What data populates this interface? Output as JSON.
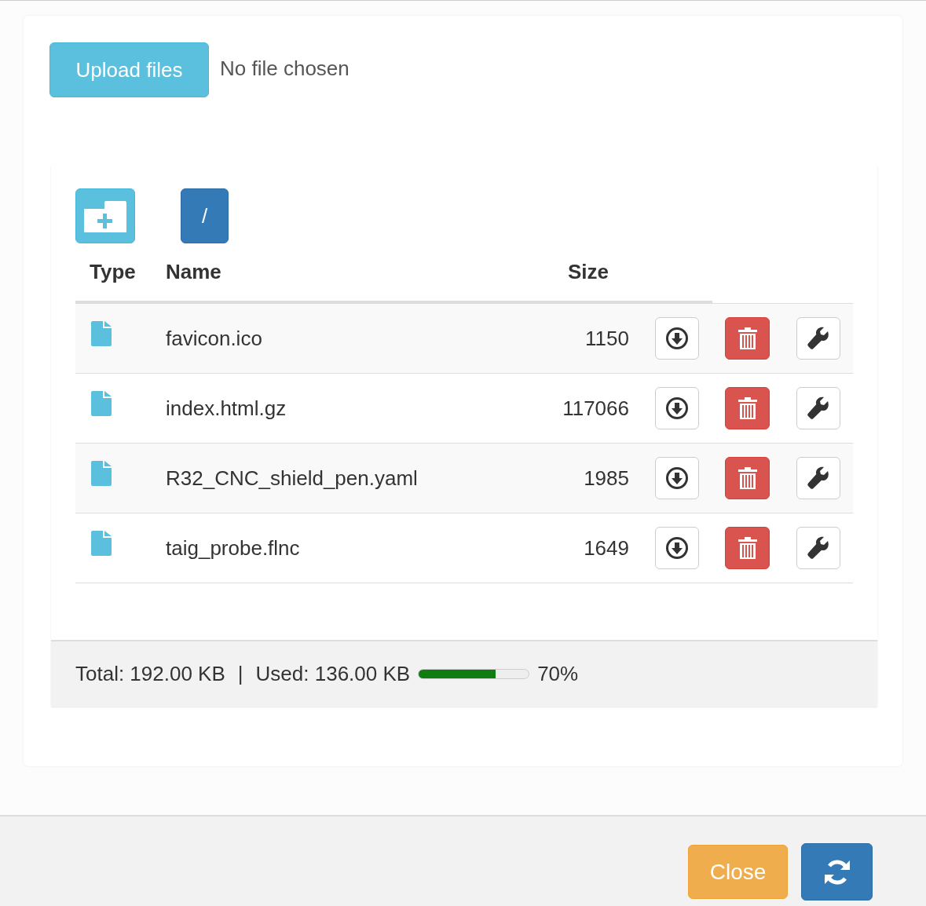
{
  "upload": {
    "button": "Upload files",
    "status": "No file chosen"
  },
  "toolbar": {
    "path_button": "/"
  },
  "table": {
    "columns": [
      "Type",
      "Name",
      "Size"
    ],
    "rows": [
      {
        "name": "favicon.ico",
        "size": "1150"
      },
      {
        "name": "index.html.gz",
        "size": "117066"
      },
      {
        "name": "R32_CNC_shield_pen.yaml",
        "size": "1985"
      },
      {
        "name": "taig_probe.flnc",
        "size": "1649"
      }
    ]
  },
  "usage": {
    "total": "Total: 192.00 KB",
    "separator": "|",
    "used": "Used: 136.00 KB",
    "level": 0.7,
    "percent": "70%"
  },
  "footer": {
    "close_button": "Close"
  }
}
